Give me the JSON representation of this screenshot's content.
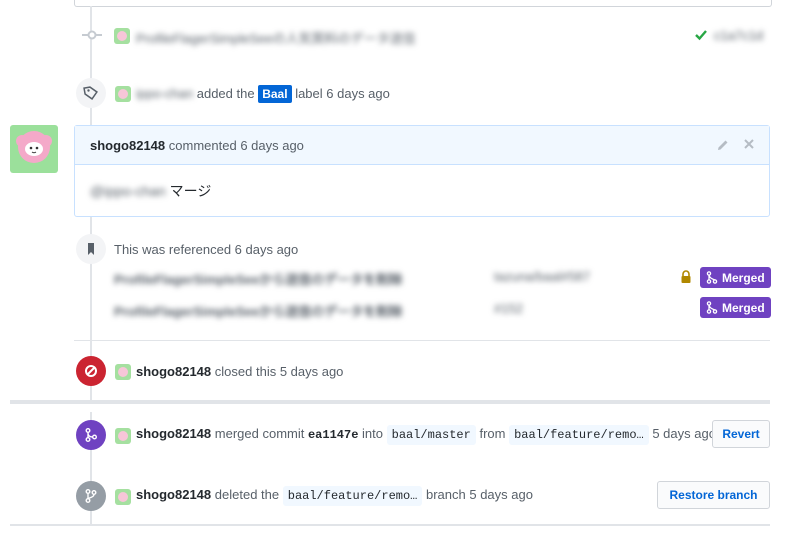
{
  "commit_row": {
    "message_blurred": "ProfileFlagerSimpleSeeの人気質料のデータ送信",
    "hash_blurred": "c1a7c1d"
  },
  "label_event": {
    "actor_blurred": "ippo-chan",
    "text_added": "added the",
    "label_name": "Baal",
    "text_suffix": "label 6 days ago"
  },
  "comment": {
    "author": "shogo82148",
    "meta": "commented 6 days ago",
    "mention_blurred": "@ippo-chan",
    "body": "マージ"
  },
  "reference": {
    "title": "This was referenced 6 days ago",
    "items": [
      {
        "title_blurred": "ProfileFlagerSimpleSeeから送信のデータを削除",
        "repo_blurred": "tazuna/baal#587",
        "status": "Merged",
        "locked": true
      },
      {
        "title_blurred": "ProfileFlagerSimpleSeeから送信のデータを削除",
        "repo_blurred": "#152",
        "status": "Merged",
        "locked": false
      }
    ]
  },
  "closed_event": {
    "author": "shogo82148",
    "text": "closed this 5 days ago"
  },
  "merged_event": {
    "author": "shogo82148",
    "text_merged": "merged commit",
    "commit": "ea1147e",
    "text_into": "into",
    "base_branch": "baal/master",
    "text_from": "from",
    "head_branch": "baal/feature/remo…",
    "time": "5 days ago",
    "revert_label": "Revert"
  },
  "deleted_event": {
    "author": "shogo82148",
    "text_deleted": "deleted the",
    "branch": "baal/feature/remo…",
    "text_suffix": "branch 5 days ago",
    "restore_label": "Restore branch"
  },
  "colors": {
    "closed": "#cb2431",
    "merged": "#6f42c1",
    "deleted": "#959da5",
    "label_blue": "#0366d6",
    "success_green": "#28a745"
  }
}
